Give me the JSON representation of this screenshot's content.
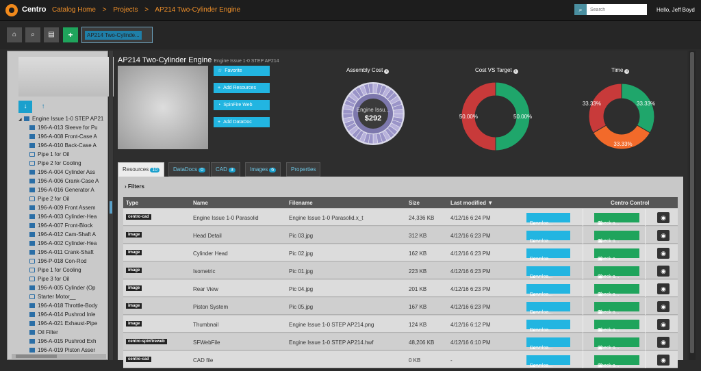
{
  "header": {
    "logo": "Centro",
    "breadcrumbs": [
      "Catalog Home",
      ">",
      "Projects",
      ">",
      "AP214 Two-Cylinder Engine"
    ],
    "search_placeholder": "Search",
    "greeting": "Hello, Jeff Boyd",
    "search_icon": "⌕"
  },
  "toolbar": {
    "home_icon": "⌂",
    "search_icon": "⌕",
    "folder_icon": "▤",
    "add_icon": "+",
    "open_tab": "AP214 Two-Cylinde..."
  },
  "sidebar": {
    "download_icon": "↓",
    "up_icon": "↑",
    "tree": [
      {
        "label": "Engine Issue 1-0 STEP AP21",
        "kind": "assembly",
        "root": true
      },
      {
        "label": "196-A-013 Sleeve for Pu",
        "kind": "assembly"
      },
      {
        "label": "196-A-008 Front-Case A",
        "kind": "assembly"
      },
      {
        "label": "196-A-010 Back-Case A",
        "kind": "assembly"
      },
      {
        "label": "Pipe 1 for Oil",
        "kind": "part"
      },
      {
        "label": "Pipe 2 for Cooling",
        "kind": "part"
      },
      {
        "label": "196-A-004 Cylinder Ass",
        "kind": "assembly"
      },
      {
        "label": "196-A-006 Crank-Case A",
        "kind": "assembly"
      },
      {
        "label": "196-A-016 Generator A",
        "kind": "assembly"
      },
      {
        "label": "Pipe 2 for Oil",
        "kind": "part"
      },
      {
        "label": "196-A-009 Front Assem",
        "kind": "assembly"
      },
      {
        "label": "196-A-003 Cylinder-Hea",
        "kind": "assembly"
      },
      {
        "label": "196-A-007 Front-Block",
        "kind": "assembly"
      },
      {
        "label": "196-A-012 Cam-Shaft A",
        "kind": "assembly"
      },
      {
        "label": "196-A-002 Cylinder-Hea",
        "kind": "assembly"
      },
      {
        "label": "196-A-011 Crank-Shaft",
        "kind": "assembly"
      },
      {
        "label": "196-P-018 Con-Rod",
        "kind": "part"
      },
      {
        "label": "Pipe 1 for Cooling",
        "kind": "part"
      },
      {
        "label": "Pipe 3 for Oil",
        "kind": "part"
      },
      {
        "label": "196-A-005 Cylinder (Op",
        "kind": "assembly"
      },
      {
        "label": "Starter Motor__",
        "kind": "part"
      },
      {
        "label": "196-A-018 Throttle-Body",
        "kind": "assembly"
      },
      {
        "label": "196-A-014 Pushrod Inle",
        "kind": "assembly"
      },
      {
        "label": "196-A-021 Exhaust-Pipe",
        "kind": "assembly"
      },
      {
        "label": "Oil Filter",
        "kind": "assembly"
      },
      {
        "label": "196-A-015 Pushrod Exh",
        "kind": "assembly"
      },
      {
        "label": "196-A-019 Piston Asser",
        "kind": "assembly"
      }
    ]
  },
  "main": {
    "title": "AP214 Two-Cylinder Engine",
    "subtitle": "Engine Issue 1-0 STEP AP214",
    "actions": [
      {
        "icon": "☆",
        "label": "Favorite"
      },
      {
        "icon": "+",
        "label": "Add Resources"
      },
      {
        "icon": "◔",
        "label": "SpinFire Web"
      },
      {
        "icon": "+",
        "label": "Add DataDoc"
      }
    ],
    "info_icon": "i",
    "tabs": [
      {
        "label": "Resources",
        "count": "10"
      },
      {
        "label": "DataDocs",
        "count": "0"
      },
      {
        "label": "CAD",
        "count": "3"
      },
      {
        "label": "Images",
        "count": "6"
      },
      {
        "label": "Properties",
        "count": ""
      }
    ],
    "filters_label": "Filters",
    "filters_icon": "›",
    "columns": {
      "type": "Type",
      "name": "Name",
      "filename": "Filename",
      "size": "Size",
      "modified": "Last modified ▼",
      "control": "Centro Control"
    },
    "download_label": "Downloa...",
    "checkout_label": "Check o...",
    "dropdown_icon": "▴",
    "round_icon": "◉",
    "download_icon": "↓",
    "lock_icon": "▣",
    "rows": [
      {
        "type": "centro-cad",
        "name": "Engine Issue 1-0 Parasolid",
        "filename": "Engine Issue 1-0 Parasolid.x_t",
        "size": "24,336 KB",
        "modified": "4/12/16 6:24 PM"
      },
      {
        "type": "image",
        "name": "Head Detail",
        "filename": "Pic 03.jpg",
        "size": "312 KB",
        "modified": "4/12/16 6:23 PM"
      },
      {
        "type": "image",
        "name": "Cylinder Head",
        "filename": "Pic 02.jpg",
        "size": "162 KB",
        "modified": "4/12/16 6:23 PM"
      },
      {
        "type": "image",
        "name": "Isometric",
        "filename": "Pic 01.jpg",
        "size": "223 KB",
        "modified": "4/12/16 6:23 PM"
      },
      {
        "type": "image",
        "name": "Rear View",
        "filename": "Pic 04.jpg",
        "size": "201 KB",
        "modified": "4/12/16 6:23 PM"
      },
      {
        "type": "image",
        "name": "Piston System",
        "filename": "Pic 05.jpg",
        "size": "167 KB",
        "modified": "4/12/16 6:23 PM"
      },
      {
        "type": "image",
        "name": "Thumbnail",
        "filename": "Engine Issue 1-0 STEP AP214.png",
        "size": "124 KB",
        "modified": "4/12/16 6:12 PM"
      },
      {
        "type": "centro-spinfireweb",
        "name": "SFWebFile",
        "filename": "Engine Issue 1-0 STEP AP214.hwf",
        "size": "48,206 KB",
        "modified": "4/12/16 6:10 PM"
      },
      {
        "type": "centro-cad",
        "name": "CAD file",
        "filename": "",
        "size": "0 KB",
        "modified": "-"
      }
    ]
  },
  "charts": {
    "assembly": {
      "title": "Assembly Cost",
      "center_label": "Engine Issu...",
      "center_value": "$292"
    },
    "cost_vs_target": {
      "title": "Cost VS Target",
      "slices": [
        {
          "label": "50.00%",
          "value": 50,
          "color": "#1fa66b"
        },
        {
          "label": "50.00%",
          "value": 50,
          "color": "#c83a3a"
        }
      ]
    },
    "time": {
      "title": "Time",
      "slices": [
        {
          "label": "33.33%",
          "value": 33.33,
          "color": "#1fa66b"
        },
        {
          "label": "33.33%",
          "value": 33.33,
          "color": "#f26a2a"
        },
        {
          "label": "33.33%",
          "value": 33.34,
          "color": "#c83a3a"
        }
      ]
    }
  },
  "colors": {
    "accent": "#f0902a",
    "primary": "#22b5e1",
    "success": "#1fa45c",
    "danger": "#c83a3a"
  }
}
